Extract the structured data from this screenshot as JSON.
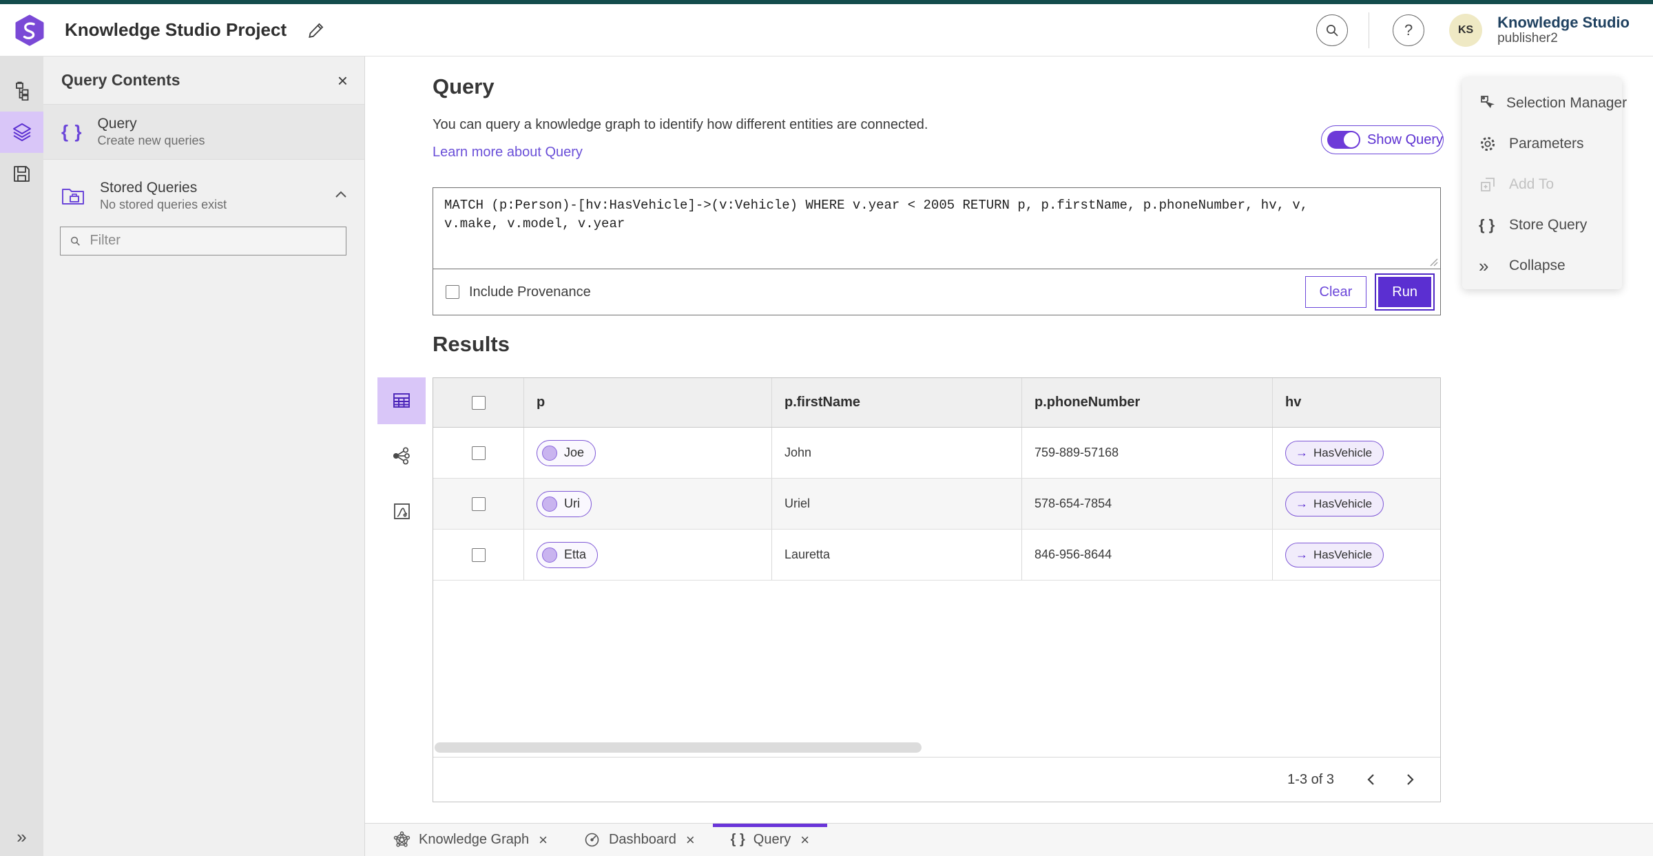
{
  "colors": {
    "accent_purple": "#5b2fd1",
    "accent_purple_light": "#d9c6f8",
    "top_strip_teal": "#134c4c",
    "link_purple": "#6a4fd8",
    "avatar_yellow": "#efe9c4"
  },
  "icons": {
    "braces": "{ }",
    "close": "×",
    "collapse_chevrons": "»",
    "arrow_right": "→",
    "help": "?"
  },
  "header": {
    "app_title": "Knowledge Studio Project",
    "user_name": "Knowledge Studio",
    "user_role": "publisher2",
    "avatar_initials": "KS"
  },
  "contents_panel": {
    "title": "Query Contents",
    "query_item": {
      "title": "Query",
      "subtitle": "Create new queries"
    },
    "stored_queries": {
      "title": "Stored Queries",
      "subtitle": "No stored queries exist"
    },
    "filter_placeholder": "Filter"
  },
  "query_section": {
    "title": "Query",
    "description": "You can query a knowledge graph to identify how different entities are connected.",
    "learn_more_link": "Learn more about Query",
    "show_query_label": "Show Query",
    "query_text": "MATCH (p:Person)-[hv:HasVehicle]->(v:Vehicle) WHERE v.year < 2005 RETURN p, p.firstName, p.phoneNumber, hv, v,\nv.make, v.model, v.year",
    "include_provenance_label": "Include Provenance",
    "clear_button": "Clear",
    "run_button": "Run"
  },
  "results": {
    "title": "Results",
    "columns": [
      "p",
      "p.firstName",
      "p.phoneNumber",
      "hv"
    ],
    "rows": [
      {
        "p": "Joe",
        "p_firstName": "John",
        "p_phoneNumber": "759-889-57168",
        "hv": "HasVehicle"
      },
      {
        "p": "Uri",
        "p_firstName": "Uriel",
        "p_phoneNumber": "578-654-7854",
        "hv": "HasVehicle"
      },
      {
        "p": "Etta",
        "p_firstName": "Lauretta",
        "p_phoneNumber": "846-956-8644",
        "hv": "HasVehicle"
      }
    ],
    "pagination_range": "1-3 of 3"
  },
  "actions_panel": {
    "items": [
      {
        "label": "Selection Manager",
        "disabled": false
      },
      {
        "label": "Parameters",
        "disabled": false
      },
      {
        "label": "Add To",
        "disabled": true
      },
      {
        "label": "Store Query",
        "disabled": false
      },
      {
        "label": "Collapse",
        "disabled": false
      }
    ]
  },
  "tab_bar": {
    "tabs": [
      {
        "label": "Knowledge Graph",
        "active": false
      },
      {
        "label": "Dashboard",
        "active": false
      },
      {
        "label": "Query",
        "active": true
      }
    ]
  }
}
